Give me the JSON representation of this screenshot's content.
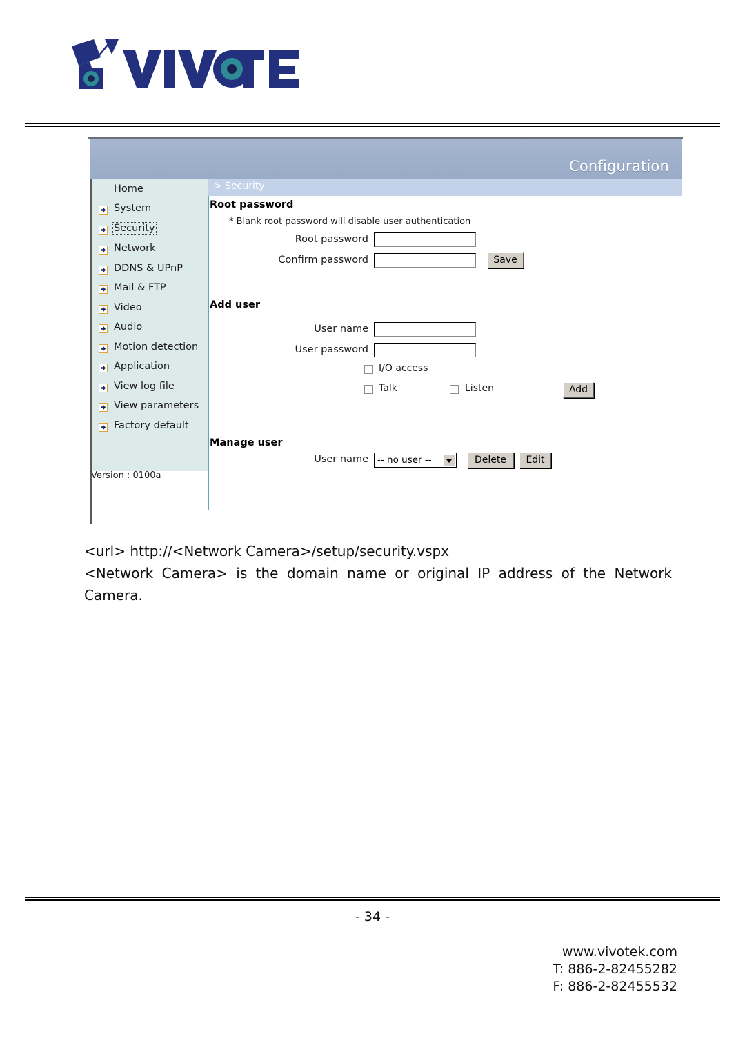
{
  "brand": {
    "name": "VIVOTEK",
    "logo_icon": "vivotek-camera-logo",
    "colors": {
      "navy": "#1f2a7a",
      "lens_teal": "#2e8b96"
    }
  },
  "screenshot": {
    "header": {
      "title": "Configuration",
      "title_bar_color": "#9eafcb",
      "breadcrumb": "> Security",
      "breadcrumb_bar_color": "#c3d2e8"
    },
    "sidebar": {
      "background_color": "#dcebe9",
      "version_label": "Version : 0100a",
      "items": [
        {
          "label": "Home",
          "icon": "",
          "selected": false
        },
        {
          "label": "System",
          "icon": "arrow-right-icon",
          "selected": false
        },
        {
          "label": "Security",
          "icon": "arrow-right-icon",
          "selected": true
        },
        {
          "label": "Network",
          "icon": "arrow-right-icon",
          "selected": false
        },
        {
          "label": "DDNS & UPnP",
          "icon": "arrow-right-icon",
          "selected": false
        },
        {
          "label": "Mail & FTP",
          "icon": "arrow-right-icon",
          "selected": false
        },
        {
          "label": "Video",
          "icon": "arrow-right-icon",
          "selected": false
        },
        {
          "label": "Audio",
          "icon": "arrow-right-icon",
          "selected": false
        },
        {
          "label": "Motion detection",
          "icon": "arrow-right-icon",
          "selected": false
        },
        {
          "label": "Application",
          "icon": "arrow-right-icon",
          "selected": false
        },
        {
          "label": "View log file",
          "icon": "arrow-right-icon",
          "selected": false
        },
        {
          "label": "View parameters",
          "icon": "arrow-right-icon",
          "selected": false
        },
        {
          "label": "Factory default",
          "icon": "arrow-right-icon",
          "selected": false
        }
      ]
    },
    "root_password": {
      "section_title": "Root password",
      "note": "* Blank root password will disable user authentication",
      "root_password_label": "Root password",
      "root_password_value": "",
      "confirm_password_label": "Confirm password",
      "confirm_password_value": "",
      "save_button": "Save"
    },
    "add_user": {
      "section_title": "Add user",
      "user_name_label": "User name",
      "user_name_value": "",
      "user_password_label": "User password",
      "user_password_value": "",
      "io_access_label": "I/O access",
      "io_access_checked": false,
      "talk_label": "Talk",
      "talk_checked": false,
      "listen_label": "Listen",
      "listen_checked": false,
      "add_button": "Add"
    },
    "manage_user": {
      "section_title": "Manage user",
      "user_name_label": "User name",
      "user_select_value": "-- no user --",
      "delete_button": "Delete",
      "edit_button": "Edit"
    }
  },
  "document": {
    "url_line": "<url> http://<Network Camera>/setup/security.vspx",
    "description": "<Network Camera> is the domain name or original IP address of the Network Camera.",
    "page_number": "- 34 -",
    "footer": {
      "website": "www.vivotek.com",
      "tel": "T: 886-2-82455282",
      "fax": "F: 886-2-82455532"
    }
  }
}
